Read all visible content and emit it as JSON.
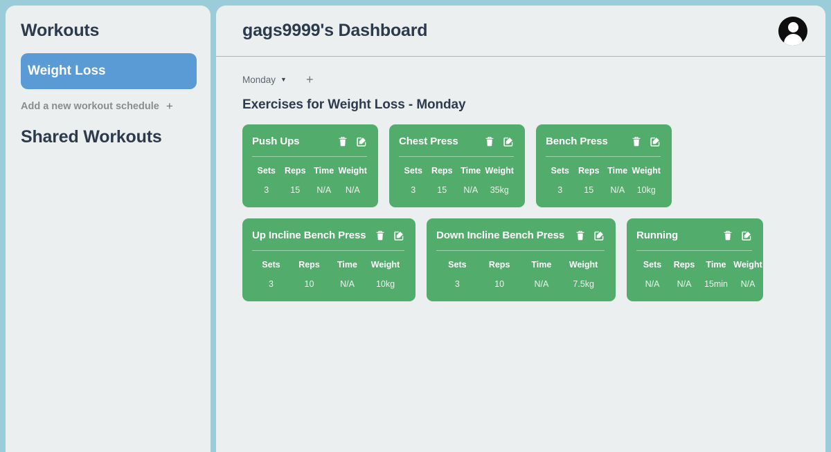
{
  "theme": {
    "page_background": "#9ACDD8",
    "panel_background": "#ECEFF0",
    "accent_blue": "#5B9BD5",
    "card_green": "#52AC6B",
    "heading_text": "#2C3A4B",
    "muted_text": "#8C8C8C"
  },
  "sidebar": {
    "title": "Workouts",
    "workouts": [
      {
        "label": "Weight Loss",
        "selected": true
      }
    ],
    "add_schedule_label": "Add a new workout schedule",
    "add_schedule_icon": "plus-icon",
    "shared_title": "Shared Workouts",
    "shared_workouts": []
  },
  "header": {
    "title": "gags9999's Dashboard",
    "avatar_icon": "user-avatar-icon"
  },
  "content": {
    "day_selector": {
      "selected": "Monday",
      "caret_icon": "chevron-down-icon",
      "options": [
        "Monday"
      ]
    },
    "add_day_icon": "plus-icon",
    "add_day_label": "+",
    "section_title": "Exercises for Weight Loss - Monday",
    "stat_headers": [
      "Sets",
      "Reps",
      "Time",
      "Weight"
    ],
    "action_icons": {
      "delete": "trash-icon",
      "edit": "edit-pencil-square-icon"
    },
    "rows": [
      {
        "cards": [
          {
            "name": "Push Ups",
            "sets": "3",
            "reps": "15",
            "time": "N/A",
            "weight": "N/A"
          },
          {
            "name": "Chest Press",
            "sets": "3",
            "reps": "15",
            "time": "N/A",
            "weight": "35kg"
          },
          {
            "name": "Bench Press",
            "sets": "3",
            "reps": "15",
            "time": "N/A",
            "weight": "10kg"
          }
        ]
      },
      {
        "cards": [
          {
            "name": "Up Incline Bench Press",
            "sets": "3",
            "reps": "10",
            "time": "N/A",
            "weight": "10kg"
          },
          {
            "name": "Down Incline Bench Press",
            "sets": "3",
            "reps": "10",
            "time": "N/A",
            "weight": "7.5kg"
          },
          {
            "name": "Running",
            "sets": "N/A",
            "reps": "N/A",
            "time": "15min",
            "weight": "N/A"
          }
        ]
      }
    ]
  }
}
